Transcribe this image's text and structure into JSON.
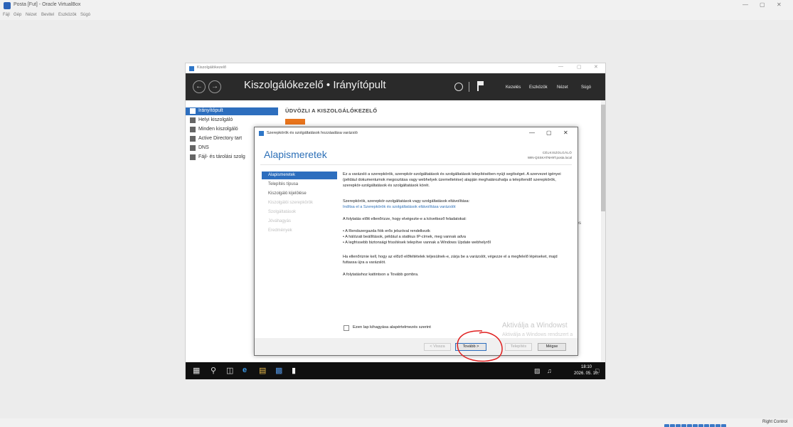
{
  "vbox": {
    "title": "Posta [Fut] - Oracle VirtualBox",
    "menu": [
      "Fájl",
      "Gép",
      "Nézet",
      "Bevitel",
      "Eszközök",
      "Súgó"
    ],
    "window_controls": [
      "—",
      "▢",
      "✕"
    ],
    "host_key": "Right Control"
  },
  "server_manager": {
    "title": "Kiszolgálókezelő",
    "breadcrumb": "Kiszolgálókezelő • Irányítópult",
    "menu": [
      "Kezelés",
      "Eszközök",
      "Nézet",
      "Súgó"
    ],
    "welcome": "ÜDVÖZLI A KISZOLGÁLÓKEZELŐ",
    "right_fragment": "tés",
    "sidebar": [
      {
        "label": "Irányítópult",
        "icon": "dashboard-icon",
        "active": true
      },
      {
        "label": "Helyi kiszolgáló",
        "icon": "server-icon",
        "active": false
      },
      {
        "label": "Minden kiszolgáló",
        "icon": "servers-icon",
        "active": false
      },
      {
        "label": "Active Directory tart",
        "icon": "directory-icon",
        "active": false
      },
      {
        "label": "DNS",
        "icon": "dns-icon",
        "active": false
      },
      {
        "label": "Fájl- és tárolási szolg",
        "icon": "storage-icon",
        "active": false
      }
    ]
  },
  "wizard": {
    "title": "Szerepkörök és szolgáltatások hozzáadása varázsló",
    "heading": "Alapismeretek",
    "target_label": "CÉLKISZOLGÁLÓ",
    "target_value": "WIN-QSSKATNH9T.posta.local",
    "steps": [
      {
        "label": "Alapismeretek",
        "state": "active"
      },
      {
        "label": "Telepítés típusa",
        "state": "enabled"
      },
      {
        "label": "Kiszolgáló kijelölése",
        "state": "enabled"
      },
      {
        "label": "Kiszolgálói szerepkörök",
        "state": "disabled"
      },
      {
        "label": "Szolgáltatások",
        "state": "disabled"
      },
      {
        "label": "Jóváhagyás",
        "state": "disabled"
      },
      {
        "label": "Eredmények",
        "state": "disabled"
      }
    ],
    "paragraph1": "Ez a varázsló a szerepkörök, szerepkör-szolgáltatások és szolgáltatások telepítésében nyújt segítséget. A szervezet igényei (például dokumentumok megosztása vagy webhelyek üzemeltetése) alapján meghatározhatja a telepítendő szerepkörök, szerepkör-szolgáltatások és szolgáltatások körét.",
    "remove_intro": "Szerepkörök, szerepkör-szolgáltatások vagy szolgáltatások eltávolítása:",
    "remove_link": "Indítsa el a Szerepkörök és szolgáltatások eltávolítása varázslót",
    "check_intro": "A folytatás előtt ellenőrizze, hogy elvégezte-e a következő feladatokat:",
    "checklist": [
      "A Rendszergazda fiók erős jelszóval rendelkezik",
      "A hálózati beállítások, például a statikus IP-címek, meg vannak adva",
      "A legfrissebb biztonsági frissítések telepítve vannak a Windows Update webhelyről"
    ],
    "paragraph2": "Ha ellenőriznie kell, hogy az előző előfeltételek teljesülnek-e, zárja be a varázslót, végezze el a megfelelő lépéseket, majd futtassa újra a varázslót.",
    "paragraph3": "A folytatáshoz kattintson a Tovább gombra.",
    "skip_checkbox": "Ezen lap kihagyása alapértelmezés szerint",
    "buttons": {
      "back": "< Vissza",
      "next": "Tovább >",
      "install": "Telepítés",
      "cancel": "Mégse"
    }
  },
  "watermark": {
    "line1": "Aktiválja a Windowst",
    "line2": "Aktiválja a Windows rendszert a"
  },
  "taskbar": {
    "time": "18:10",
    "date": "2026. 05. 10."
  },
  "colors": {
    "accent": "#2d6ebe",
    "header_bg": "#2a2a2a",
    "annotation": "#e02020"
  }
}
